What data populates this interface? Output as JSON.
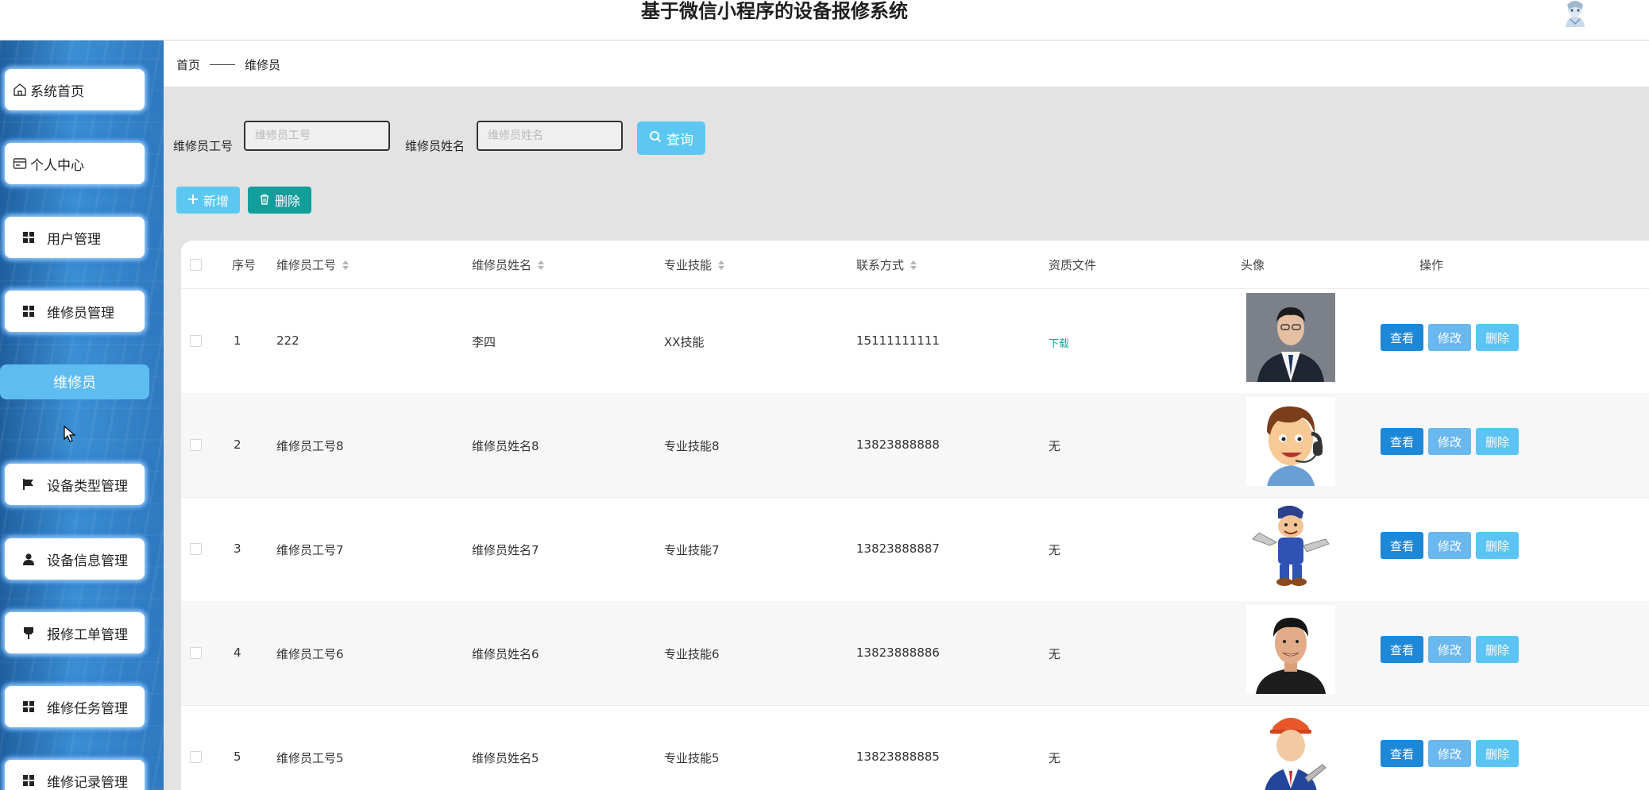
{
  "app": {
    "title": "基于微信小程序的设备报修系统"
  },
  "sidebar": {
    "items": [
      {
        "label": "系统首页",
        "icon": "home-icon"
      },
      {
        "label": "个人中心",
        "icon": "id-card-icon"
      },
      {
        "label": "用户管理",
        "icon": "grid-icon"
      },
      {
        "label": "维修员管理",
        "icon": "grid-icon"
      },
      {
        "label": "设备类型管理",
        "icon": "flag-icon"
      },
      {
        "label": "设备信息管理",
        "icon": "user-icon"
      },
      {
        "label": "报修工单管理",
        "icon": "pin-icon"
      },
      {
        "label": "维修任务管理",
        "icon": "grid-icon"
      },
      {
        "label": "维修记录管理",
        "icon": "grid-icon"
      }
    ],
    "active_sub": "维修员"
  },
  "breadcrumb": {
    "home": "首页",
    "current": "维修员"
  },
  "search": {
    "id_label": "维修员工号",
    "id_placeholder": "维修员工号",
    "name_label": "维修员姓名",
    "name_placeholder": "维修员姓名",
    "query_label": "查询"
  },
  "toolbar": {
    "add_label": "新增",
    "delete_label": "删除"
  },
  "table": {
    "headers": {
      "index": "序号",
      "worker_id": "维修员工号",
      "worker_name": "维修员姓名",
      "skill": "专业技能",
      "phone": "联系方式",
      "qualification": "资质文件",
      "avatar": "头像",
      "actions": "操作"
    },
    "action_labels": {
      "view": "查看",
      "edit": "修改",
      "delete": "删除"
    },
    "rows": [
      {
        "index": "1",
        "worker_id": "222",
        "worker_name": "李四",
        "skill": "XX技能",
        "phone": "15111111111",
        "qualification": "下载",
        "qualification_is_link": true,
        "photo": "businessman-photo"
      },
      {
        "index": "2",
        "worker_id": "维修员工号8",
        "worker_name": "维修员姓名8",
        "skill": "专业技能8",
        "phone": "13823888888",
        "qualification": "无",
        "qualification_is_link": false,
        "photo": "cartoon-headset-photo"
      },
      {
        "index": "3",
        "worker_id": "维修员工号7",
        "worker_name": "维修员姓名7",
        "skill": "专业技能7",
        "phone": "13823888887",
        "qualification": "无",
        "qualification_is_link": false,
        "photo": "cartoon-plumber-photo"
      },
      {
        "index": "4",
        "worker_id": "维修员工号6",
        "worker_name": "维修员姓名6",
        "skill": "专业技能6",
        "phone": "13823888886",
        "qualification": "无",
        "qualification_is_link": false,
        "photo": "smiling-man-photo"
      },
      {
        "index": "5",
        "worker_id": "维修员工号5",
        "worker_name": "维修员姓名5",
        "skill": "专业技能5",
        "phone": "13823888885",
        "qualification": "无",
        "qualification_is_link": false,
        "photo": "cartoon-engineer-photo"
      }
    ]
  },
  "colors": {
    "primary_button": "#1e88d8",
    "light_button": "#5cc8f2",
    "delete_toolbar": "#129e9a",
    "link": "#13a89e",
    "sidebar_active": "#5fbcf0"
  }
}
